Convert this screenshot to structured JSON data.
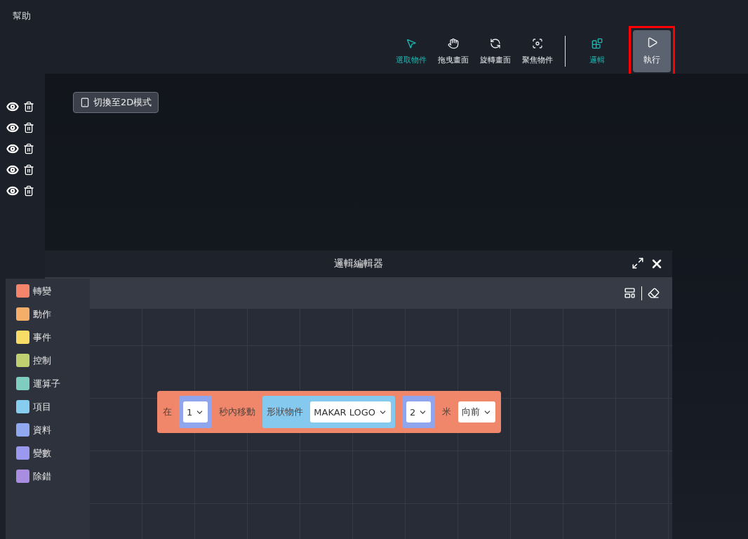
{
  "menu": {
    "help": "幫助"
  },
  "toolbar": {
    "tools": [
      {
        "label": "選取物件",
        "kind": "tool",
        "selected": true
      },
      {
        "label": "拖曳畫面",
        "kind": "tool",
        "selected": false
      },
      {
        "label": "旋轉畫面",
        "kind": "tool",
        "selected": false
      },
      {
        "label": "聚焦物件",
        "kind": "tool",
        "selected": false
      },
      {
        "label": "邏輯",
        "kind": "tool",
        "selected": true
      },
      {
        "label": "執行",
        "kind": "run",
        "selected": false,
        "highlighted": true
      }
    ]
  },
  "layers": [
    {
      "visible": true
    },
    {
      "visible": true
    },
    {
      "visible": true
    },
    {
      "visible": true
    },
    {
      "visible": true
    }
  ],
  "viewport": {
    "mode_button": "切換至2D模式"
  },
  "editor": {
    "title": "邏輯編輯器",
    "categories": [
      {
        "label": "轉變",
        "color": "#f4846a"
      },
      {
        "label": "動作",
        "color": "#f5ad6a"
      },
      {
        "label": "事件",
        "color": "#f9dc66"
      },
      {
        "label": "控制",
        "color": "#bfd070"
      },
      {
        "label": "運算子",
        "color": "#7ecdc0"
      },
      {
        "label": "項目",
        "color": "#86cdf0"
      },
      {
        "label": "資料",
        "color": "#8fa8ef"
      },
      {
        "label": "變數",
        "color": "#9a98ef"
      },
      {
        "label": "除錯",
        "color": "#a88de0"
      }
    ],
    "block": {
      "parts": [
        {
          "kind": "text",
          "text": "在"
        },
        {
          "kind": "number",
          "value": "1"
        },
        {
          "kind": "text",
          "text": "秒內移動"
        },
        {
          "kind": "object",
          "label": "形狀物件",
          "value": "MAKAR LOGO"
        },
        {
          "kind": "number",
          "value": "2"
        },
        {
          "kind": "text",
          "text": "米"
        },
        {
          "kind": "dropdown",
          "value": "向前"
        }
      ]
    }
  }
}
